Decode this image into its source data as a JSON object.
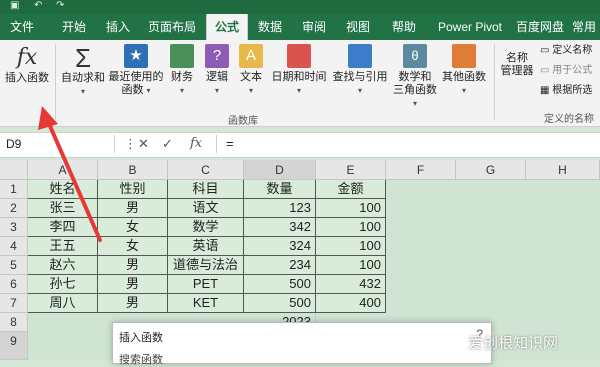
{
  "tabs": [
    "文件",
    "开始",
    "插入",
    "页面布局",
    "公式",
    "数据",
    "审阅",
    "视图",
    "帮助",
    "Power Pivot",
    "百度网盘",
    "常用"
  ],
  "active_tab": "公式",
  "ribbon": {
    "insert_function": "插入函数",
    "autosum": "自动求和",
    "recent1": "最近使用的",
    "recent2": "函数",
    "financial": "财务",
    "logical": "逻辑",
    "text": "文本",
    "datetime": "日期和时间",
    "lookup": "查找与引用",
    "math1": "数学和",
    "math2": "三角函数",
    "more": "其他函数",
    "name_mgr1": "名称",
    "name_mgr2": "管理器",
    "define_name": "定义名称",
    "use_in_formula": "用于公式",
    "create_from_sel": "根据所选",
    "group_library": "函数库",
    "group_names": "定义的名称"
  },
  "formula_bar": {
    "name_box": "D9",
    "cancel": "✕",
    "enter": "✓",
    "fx": "fx",
    "eq": "="
  },
  "columns": [
    "A",
    "B",
    "C",
    "D",
    "E",
    "F",
    "G",
    "H"
  ],
  "rows": [
    "1",
    "2",
    "3",
    "4",
    "5",
    "6",
    "7",
    "8",
    "9"
  ],
  "table": {
    "headers": [
      "姓名",
      "性别",
      "科目",
      "数量",
      "金额"
    ],
    "data": [
      [
        "张三",
        "男",
        "语文",
        "123",
        "100"
      ],
      [
        "李四",
        "女",
        "数学",
        "342",
        "100"
      ],
      [
        "王五",
        "女",
        "英语",
        "324",
        "100"
      ],
      [
        "赵六",
        "男",
        "道德与法治",
        "234",
        "100"
      ],
      [
        "孙七",
        "男",
        "PET",
        "500",
        "432"
      ],
      [
        "周八",
        "男",
        "KET",
        "500",
        "400"
      ]
    ],
    "d8": "2023"
  },
  "dialog": {
    "title": "插入函数",
    "help": "?",
    "sub": "搜索函数"
  },
  "watermark": "爱创根知识网",
  "colors": {
    "brand": "#217346",
    "arrow": "#e53935"
  }
}
